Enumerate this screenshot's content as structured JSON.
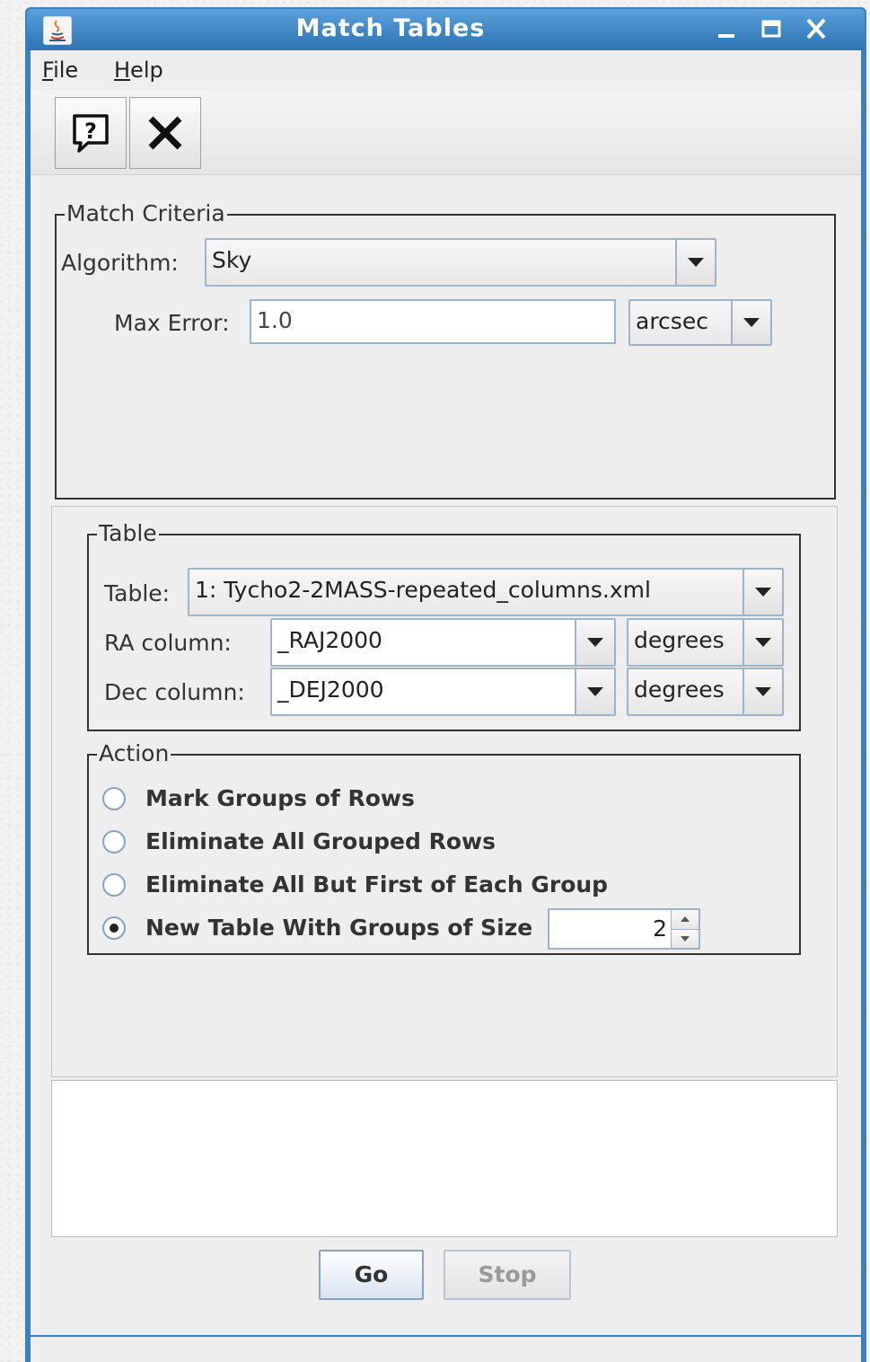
{
  "window": {
    "title": "Match Tables",
    "controls": [
      "minimize-icon",
      "maximize-icon",
      "close-icon"
    ]
  },
  "menu": {
    "file": {
      "mnemonic": "F",
      "rest": "ile"
    },
    "help": {
      "mnemonic": "H",
      "rest": "elp"
    }
  },
  "toolbar": {
    "icons": [
      "help-icon",
      "close-icon"
    ]
  },
  "match_criteria": {
    "legend": "Match Criteria",
    "algorithm_label": "Algorithm:",
    "algorithm_value": "Sky",
    "max_error_label": "Max Error:",
    "max_error_value": "1.0",
    "max_error_unit": "arcsec"
  },
  "table_group": {
    "legend": "Table",
    "table_label": "Table:",
    "table_value": "1: Tycho2-2MASS-repeated_columns.xml",
    "ra_label": "RA column:",
    "ra_value": "_RAJ2000",
    "ra_unit": "degrees",
    "dec_label": "Dec column:",
    "dec_value": "_DEJ2000",
    "dec_unit": "degrees"
  },
  "action": {
    "legend": "Action",
    "options": [
      {
        "label": "Mark Groups of Rows",
        "selected": false
      },
      {
        "label": "Eliminate All Grouped Rows",
        "selected": false
      },
      {
        "label": "Eliminate All But First of Each Group",
        "selected": false
      },
      {
        "label": "New Table With Groups of Size",
        "selected": true
      }
    ],
    "group_size": "2"
  },
  "buttons": {
    "go": "Go",
    "stop": "Stop"
  },
  "colors": {
    "titlebar": "#3f86c4",
    "background": "#eeeeee",
    "disabled_text": "#9a9a9a"
  }
}
